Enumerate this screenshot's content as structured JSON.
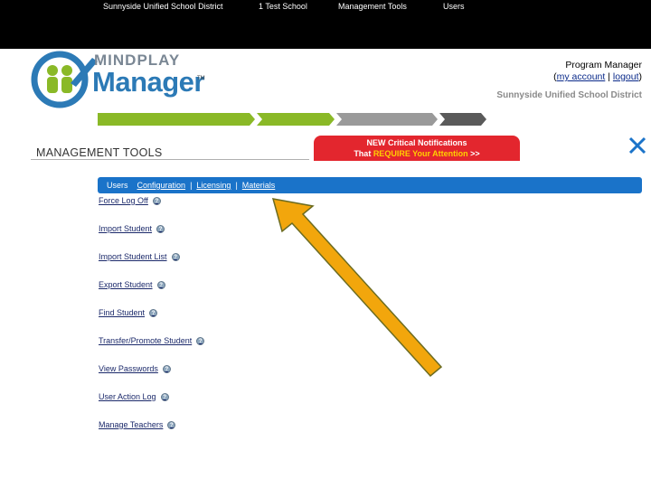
{
  "logo": {
    "line1": "MINDPLAY",
    "line2": "Manager",
    "tm": "TM"
  },
  "header": {
    "role": "Program Manager",
    "my_account": "my account",
    "logout": "logout",
    "district": "Sunnyside Unified School District"
  },
  "breadcrumbs": [
    {
      "label": "Sunnyside Unified School District",
      "color": "#8ab927"
    },
    {
      "label": "1 Test School",
      "color": "#8ab927"
    },
    {
      "label": "Management Tools",
      "color": "#9a9a9a"
    },
    {
      "label": "Users",
      "color": "#5a5a5a"
    }
  ],
  "page_title": "MANAGEMENT TOOLS",
  "notification": {
    "line1": "NEW Critical Notifications",
    "line2_pre": "That ",
    "line2_hl": "REQUIRE Your Attention",
    "line2_post": " >>"
  },
  "tabs": {
    "users": "Users",
    "configuration": "Configuration",
    "licensing": "Licensing",
    "materials": "Materials",
    "sep": "|"
  },
  "menu_items": [
    "Force Log Off",
    "Import Student",
    "Import Student List",
    "Export Student",
    "Find Student",
    "Transfer/Promote Student",
    "View Passwords",
    "User Action Log",
    "Manage Teachers"
  ],
  "colors": {
    "tabbar": "#1a73c9",
    "notification": "#e3262e",
    "arrow": "#f2a60c"
  },
  "icons": {
    "close": "close-x-icon",
    "info": "info-icon"
  }
}
